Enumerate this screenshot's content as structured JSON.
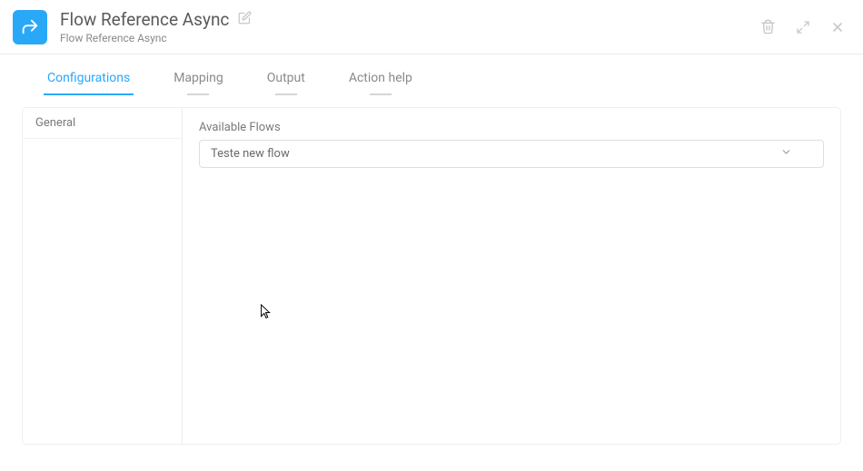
{
  "header": {
    "title": "Flow Reference Async",
    "subtitle": "Flow Reference Async"
  },
  "tabs": {
    "configurations": "Configurations",
    "mapping": "Mapping",
    "output": "Output",
    "action_help": "Action help"
  },
  "sidebar": {
    "general": "General"
  },
  "form": {
    "available_flows_label": "Available Flows",
    "available_flows_value": "Teste new flow"
  }
}
